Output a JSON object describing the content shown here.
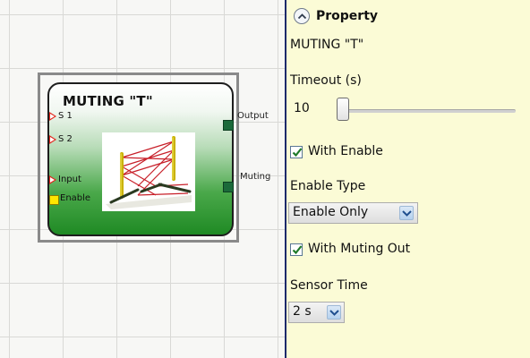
{
  "canvas": {
    "block": {
      "title": "MUTING \"T\"",
      "inputs": [
        {
          "label": "S 1"
        },
        {
          "label": "S 2"
        },
        {
          "label": "Input"
        },
        {
          "label": "Enable"
        }
      ],
      "outputs": [
        {
          "label": "Output"
        },
        {
          "label": "Muting"
        }
      ]
    }
  },
  "panel": {
    "title": "Property",
    "block_name": "MUTING \"T\"",
    "timeout": {
      "label": "Timeout (s)",
      "value": "10",
      "slider_level": 0.0
    },
    "with_enable": {
      "label": "With Enable",
      "checked": true
    },
    "enable_type": {
      "label": "Enable Type",
      "selected": "Enable Only"
    },
    "with_muting_out": {
      "label": "With Muting Out",
      "checked": true
    },
    "sensor_time": {
      "label": "Sensor Time",
      "selected": "2 s"
    }
  },
  "colors": {
    "panel_bg": "#fbfbd6",
    "block_green": "#1f8a24",
    "input_arrow": "#e2231a",
    "enable_port": "#ffe600",
    "output_port": "#1b6a3a",
    "checkbox_tick": "#1e7a28",
    "dropdown_accent": "#b5d1ee"
  },
  "icons": {
    "collapse": "chevron-up-icon",
    "checkbox": "checkmark-icon",
    "dropdown": "chevron-down-icon",
    "block_image": "muting-t-sensor-illustration"
  }
}
